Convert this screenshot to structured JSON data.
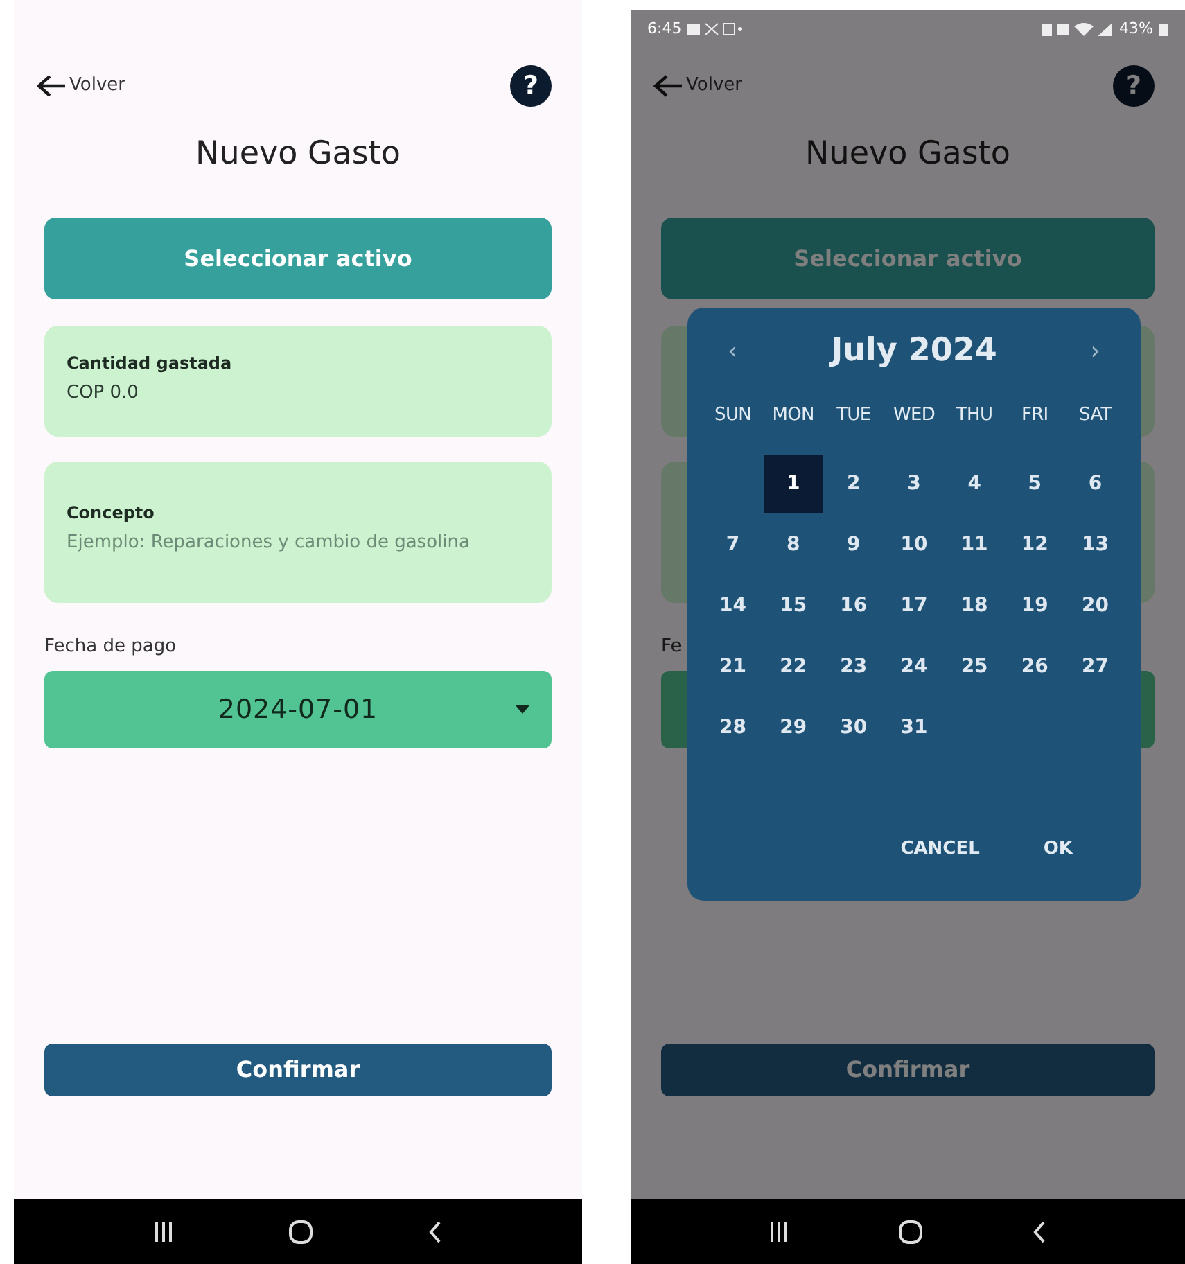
{
  "form_screen": {
    "back_label": "Volver",
    "help": "?",
    "title": "Nuevo Gasto",
    "select_button": "Seleccionar activo",
    "fields": [
      {
        "label": "Cantidad gastada",
        "value": "COP 0.0"
      },
      {
        "label": "Concepto",
        "placeholder": "Ejemplo: Reparaciones y cambio de gasolina"
      }
    ],
    "date_label": "Fecha de pago",
    "date_value": "2024-07-01",
    "confirm_button": "Confirmar"
  },
  "picker_screen": {
    "status_bar": {
      "time": "6:45",
      "battery": "43%"
    },
    "back_label": "Volver",
    "help": "?",
    "title": "Nuevo Gasto",
    "select_button": "Seleccionar activo",
    "date_label": "Fe",
    "confirm_button": "Confirmar",
    "date_picker": {
      "prev": "‹",
      "month": "July 2024",
      "next": "›",
      "weekdays": [
        "SUN",
        "MON",
        "TUE",
        "WED",
        "THU",
        "FRI",
        "SAT"
      ],
      "weeks": [
        {
          "days": [
            {
              "day": "1",
              "selected": true
            },
            {
              "day": "2",
              "selected": false
            },
            {
              "day": "3",
              "selected": false
            },
            {
              "day": "4",
              "selected": false
            },
            {
              "day": "5",
              "selected": false
            },
            {
              "day": "6",
              "selected": false
            }
          ]
        },
        {
          "days": [
            {
              "day": "7",
              "selected": false
            },
            {
              "day": "8",
              "selected": false
            },
            {
              "day": "9",
              "selected": false
            },
            {
              "day": "10",
              "selected": false
            },
            {
              "day": "11",
              "selected": false
            },
            {
              "day": "12",
              "selected": false
            },
            {
              "day": "13",
              "selected": false
            }
          ]
        },
        {
          "days": [
            {
              "day": "14",
              "selected": false
            },
            {
              "day": "15",
              "selected": false
            },
            {
              "day": "16",
              "selected": false
            },
            {
              "day": "17",
              "selected": false
            },
            {
              "day": "18",
              "selected": false
            },
            {
              "day": "19",
              "selected": false
            },
            {
              "day": "20",
              "selected": false
            }
          ]
        },
        {
          "days": [
            {
              "day": "21",
              "selected": false
            },
            {
              "day": "22",
              "selected": false
            },
            {
              "day": "23",
              "selected": false
            },
            {
              "day": "24",
              "selected": false
            },
            {
              "day": "25",
              "selected": false
            },
            {
              "day": "26",
              "selected": false
            },
            {
              "day": "27",
              "selected": false
            }
          ]
        },
        {
          "days": [
            {
              "day": "28",
              "selected": false
            },
            {
              "day": "29",
              "selected": false
            },
            {
              "day": "30",
              "selected": false
            },
            {
              "day": "31",
              "selected": false
            }
          ]
        }
      ],
      "buttons": [
        "CANCEL",
        "OK"
      ]
    }
  }
}
